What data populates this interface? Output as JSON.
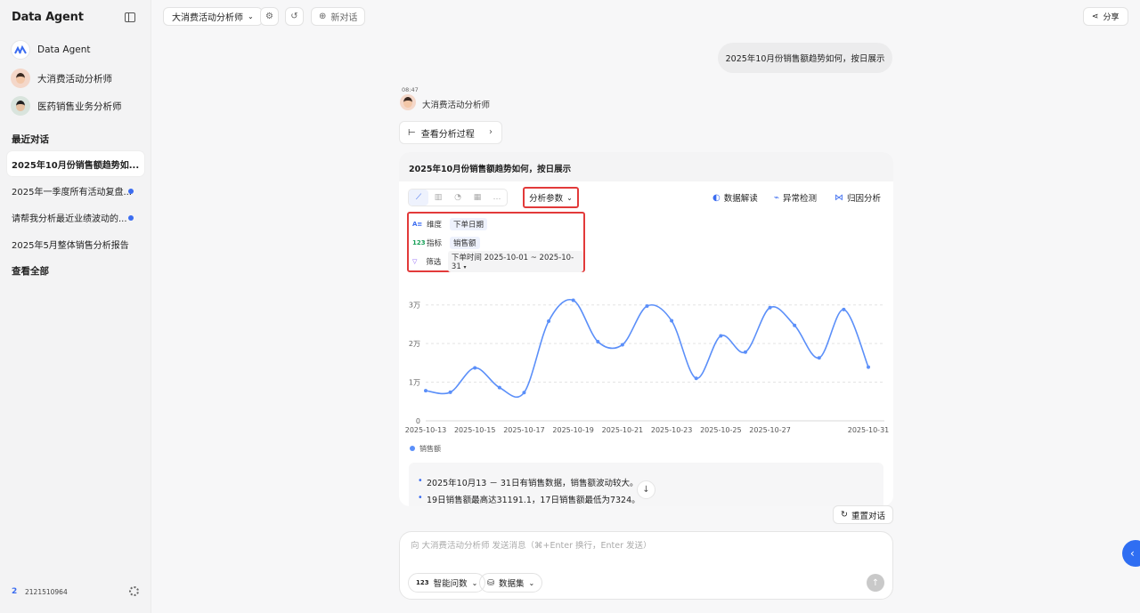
{
  "sidebar": {
    "brand": "Data Agent",
    "agents": [
      {
        "label": "Data Agent"
      },
      {
        "label": "大消费活动分析师"
      },
      {
        "label": "医药销售业务分析师"
      }
    ],
    "recent_title": "最近对话",
    "conversations": [
      {
        "label": "2025年10月份销售额趋势如...",
        "active": true,
        "unread": false
      },
      {
        "label": "2025年一季度所有活动复盘...",
        "active": false,
        "unread": true
      },
      {
        "label": "请帮我分析最近业绩波动的...",
        "active": false,
        "unread": true
      },
      {
        "label": "2025年5月整体销售分析报告",
        "active": false,
        "unread": false
      }
    ],
    "view_all": "查看全部",
    "user_badge": "2",
    "user_id": "2121510964"
  },
  "topbar": {
    "agent_selector": "大消费活动分析师",
    "new_chat": "新对话",
    "share": "分享"
  },
  "chat": {
    "user_message": "2025年10月份销售额趋势如何，按日展示",
    "time": "08:47",
    "bot_name": "大消费活动分析师",
    "process_label": "查看分析过程",
    "card_title": "2025年10月份销售额趋势如何，按日展示",
    "param_button": "分析参数",
    "tools": [
      "数据解读",
      "异常检测",
      "归因分析"
    ],
    "params": {
      "dimension_label": "维度",
      "dimension_value": "下单日期",
      "metric_label": "指标",
      "metric_value": "销售额",
      "filter_label": "筛选",
      "filter_value": "下单时间 2025-10-01 ~ 2025-10-31"
    },
    "summary": [
      "2025年10月13 － 31日有销售数据，销售额波动较大。",
      "19日销售额最高达31191.1，17日销售额最低为7324。"
    ],
    "reset": "重置对话",
    "composer_placeholder": "向 大消费活动分析师 发送消息（⌘+Enter 换行，Enter 发送）",
    "composer_pills": [
      "智能问数",
      "数据集"
    ]
  },
  "chart_data": {
    "type": "line",
    "x": [
      "2025-10-13",
      "2025-10-14",
      "2025-10-15",
      "2025-10-16",
      "2025-10-17",
      "2025-10-18",
      "2025-10-19",
      "2025-10-20",
      "2025-10-21",
      "2025-10-22",
      "2025-10-23",
      "2025-10-24",
      "2025-10-25",
      "2025-10-26",
      "2025-10-27",
      "2025-10-28",
      "2025-10-29",
      "2025-10-30",
      "2025-10-31"
    ],
    "x_tick_labels": [
      "2025-10-13",
      "2025-10-15",
      "2025-10-17",
      "2025-10-19",
      "2025-10-21",
      "2025-10-23",
      "2025-10-25",
      "2025-10-27",
      "2025-10-31"
    ],
    "x_tick_indices": [
      0,
      2,
      4,
      6,
      8,
      10,
      12,
      14,
      18
    ],
    "series": [
      {
        "name": "销售额",
        "color": "#5b8ff9",
        "values": [
          7800,
          7400,
          13700,
          8600,
          7324,
          25800,
          31191.1,
          20500,
          19700,
          29700,
          25900,
          11000,
          22000,
          17800,
          29300,
          24700,
          16300,
          28800,
          13900
        ]
      }
    ],
    "y_ticks": [
      {
        "v": 0,
        "label": "0"
      },
      {
        "v": 10000,
        "label": "1万"
      },
      {
        "v": 20000,
        "label": "2万"
      },
      {
        "v": 30000,
        "label": "3万"
      }
    ],
    "ylim": [
      0,
      35000
    ],
    "grid": true,
    "legend": "bottom-left"
  }
}
